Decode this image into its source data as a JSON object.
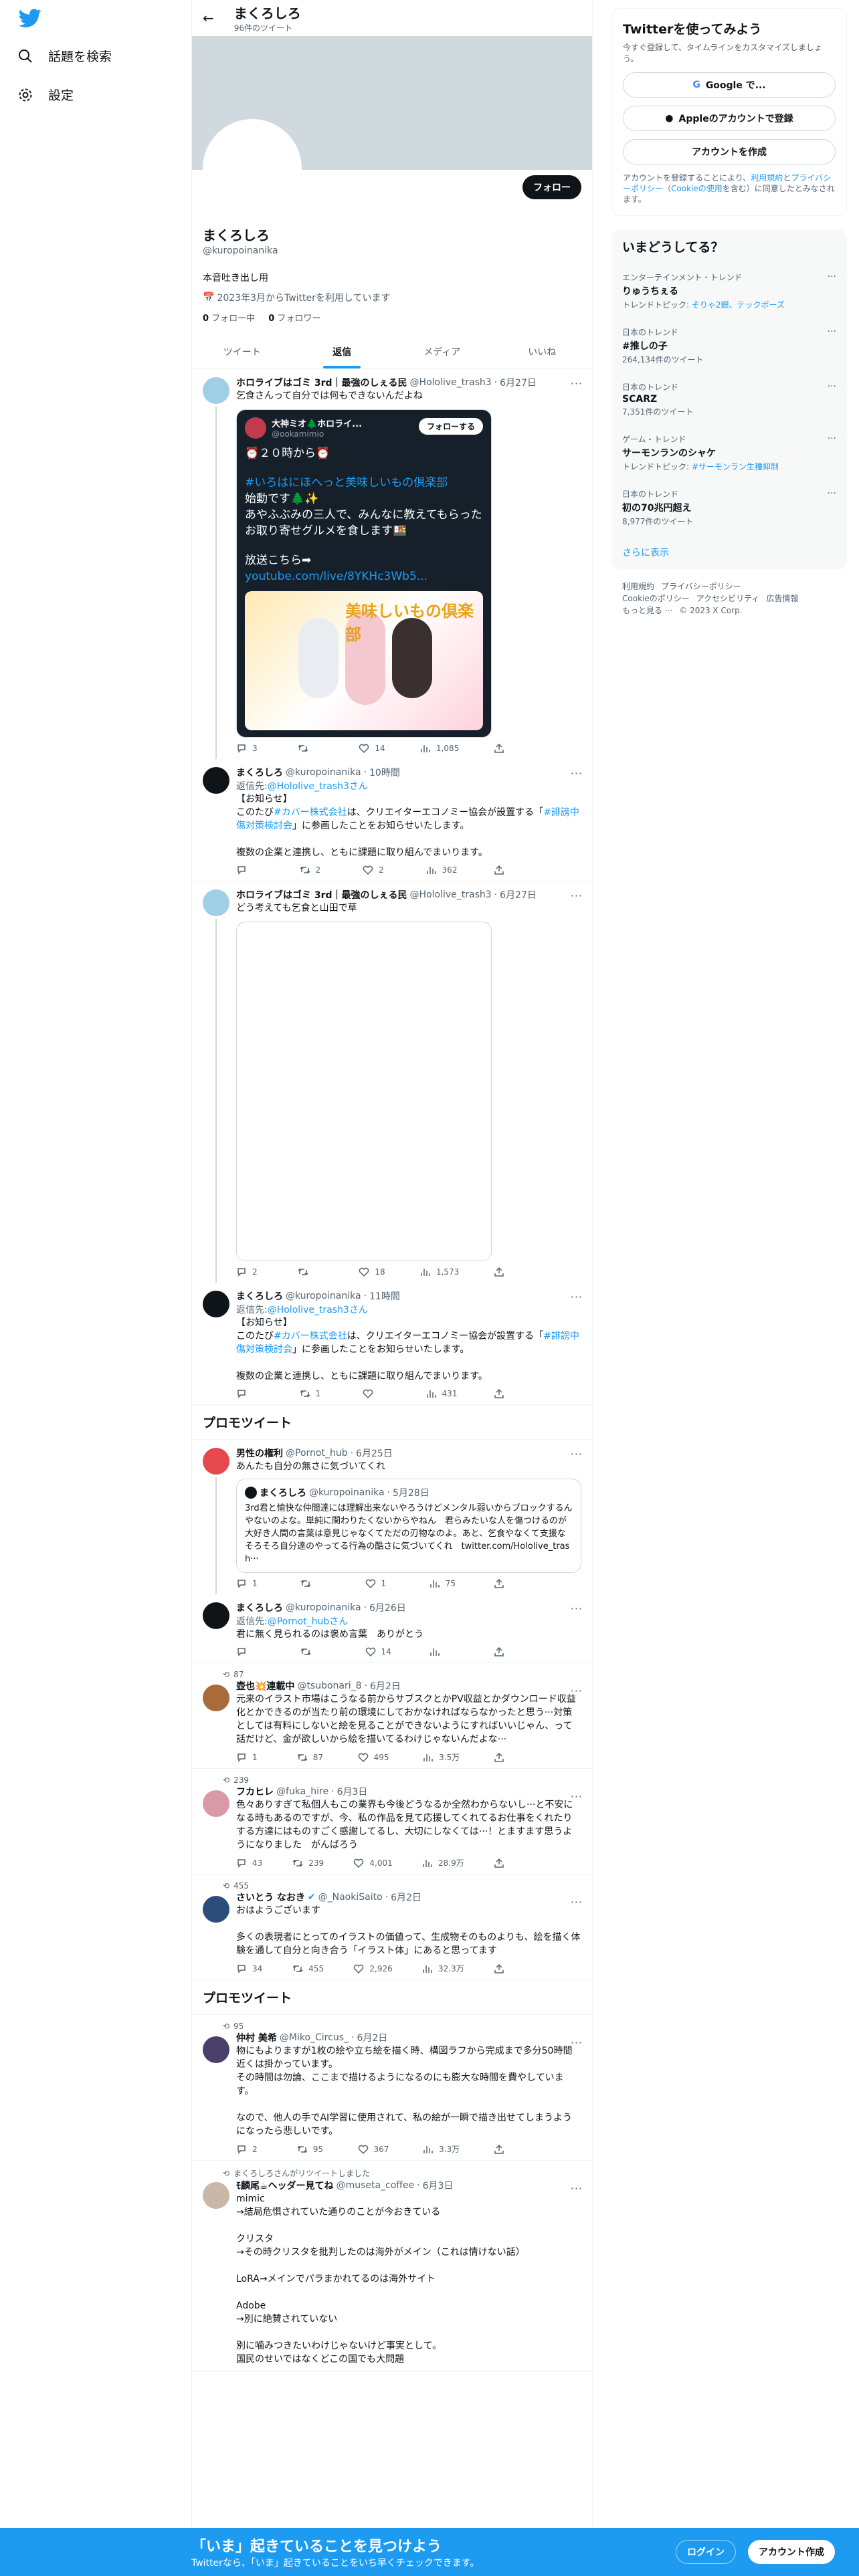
{
  "nav": {
    "explore": "話題を検索",
    "settings": "設定"
  },
  "header": {
    "name": "まくろしろ",
    "tweet_count": "96件のツイート"
  },
  "profile": {
    "follow": "フォロー",
    "name": "まくろしろ",
    "handle": "@kuropoinanika",
    "bio": "本音吐き出し用",
    "joined": "2023年3月からTwitterを利用しています",
    "following_n": "0",
    "following_l": "フォロー中",
    "followers_n": "0",
    "followers_l": "フォロワー"
  },
  "tabs": [
    "ツイート",
    "返信",
    "メディア",
    "いいね"
  ],
  "t1": {
    "name": "ホロライブはゴミ 3rd｜最強のしぇる民",
    "handle": "@Hololive_trash3",
    "date": "6月27日",
    "text": "乞食さんって自分では何もできないんだよね",
    "card": {
      "name": "大神ミオ🌲ホロライ...",
      "handle": "@ookamimio",
      "follow": "フォローする",
      "text1": "⏰２０時から⏰",
      "text2": "#いろはにほへっと美味しいもの倶楽部",
      "text3": "始動です🌲✨\nあやふぶみの三人で、みんなに教えてもらったお取り寄せグルメを食します🍱",
      "text4": "放送こちら➡",
      "link": "youtube.com/live/8YKHc3Wb5...",
      "art": "美味しいもの倶楽部"
    },
    "reply": "3",
    "rt": "",
    "like": "14",
    "views": "1,085"
  },
  "r1": {
    "name": "まくろしろ",
    "handle": "@kuropoinanika",
    "date": "10時間",
    "to": "返信先:",
    "to_h": "@Hololive_trash3さん",
    "l1": "【お知らせ】",
    "l2a": "このたび",
    "l2b": "#カバー株式会社",
    "l2c": "は、クリエイターエコノミー協会が設置する「",
    "l2d": "#誹謗中傷対策検討会",
    "l2e": "」に参画したことをお知らせいたします。",
    "l3": "複数の企業と連携し、ともに課題に取り組んでまいります。",
    "reply": "",
    "rt": "2",
    "like": "2",
    "views": "362"
  },
  "t2": {
    "name": "ホロライブはゴミ 3rd｜最強のしぇる民",
    "handle": "@Hololive_trash3",
    "date": "6月27日",
    "text": "どう考えても乞食と山田で草",
    "reply": "2",
    "rt": "",
    "like": "18",
    "views": "1,573"
  },
  "r2": {
    "name": "まくろしろ",
    "handle": "@kuropoinanika",
    "date": "11時間",
    "to": "返信先:",
    "to_h": "@Hololive_trash3さん",
    "l1": "【お知らせ】",
    "l2a": "このたび",
    "l2b": "#カバー株式会社",
    "l2c": "は、クリエイターエコノミー協会が設置する「",
    "l2d": "#誹謗中傷対策検討会",
    "l2e": "」に参画したことをお知らせいたします。",
    "l3": "複数の企業と連携し、ともに課題に取り組んでまいります。",
    "reply": "",
    "rt": "1",
    "like": "",
    "views": "431"
  },
  "promo": "プロモツイート",
  "t3": {
    "name": "男性の権利",
    "handle": "@Pornot_hub",
    "date": "6月25日",
    "text": "あんたも自分の無さに気づいてくれ",
    "q": {
      "name": "まくろしろ",
      "handle": "@kuropoinanika",
      "date": "5月28日",
      "text": "3rd君と愉快な仲間達には理解出来ないやろうけどメンタル弱いからブロックするんやないのよな。単純に関わりたくないからやねん　君らみたいな人を傷つけるのが大好き人間の言葉は意見じゃなくてただの刃物なのよ。あと、乞食やなくて支援な　そろそろ自分達のやってる行為の酷さに気づいてくれ　twitter.com/Hololive_trash···"
    },
    "reply": "1",
    "rt": "",
    "like": "1",
    "views": "75"
  },
  "r3": {
    "name": "まくろしろ",
    "handle": "@kuropoinanika",
    "date": "6月26日",
    "to": "返信先:",
    "to_h": "@Pornot_hubさん",
    "text": "君に無く見られるのは褒め言葉　ありがとう",
    "reply": "",
    "rt": "",
    "like": "14",
    "views": ""
  },
  "t4": {
    "rt": "87",
    "name": "壺也💥連載中",
    "handle": "@tsubonari_8",
    "date": "6月2日",
    "text": "元来のイラスト市場はこうなる前からサブスクとかPV収益とかダウンロード収益化とかできるのが当たり前の環境にしておかなければならなかったと思う···対策としては有料にしないと絵を見ることができないようにすればいいじゃん、って話だけど、金が欲しいから絵を描いてるわけじゃないんだよな···",
    "reply": "1",
    "like": "495",
    "views": "3.5万"
  },
  "t5": {
    "rt": "239",
    "name": "フカヒレ",
    "handle": "@fuka_hire",
    "date": "6月3日",
    "text": "色々ありすぎて私個人もこの業界も今後どうなるか全然わからないし···と不安になる時もあるのですが、今、私の作品を見て応援してくれてるお仕事をくれたりする方達にはものすごく感謝してるし、大切にしなくては···！とますます思うようになりました　がんばろう",
    "reply": "43",
    "like": "4,001",
    "views": "28.9万"
  },
  "t6": {
    "rt": "455",
    "name": "さいとう なおき",
    "handle": "@_NaokiSaito",
    "date": "6月2日",
    "text": "おはようございます\n\n多くの表現者にとってのイラストの価値って、生成物そのものよりも、絵を描く体験を通して自分と向き合う「イラスト体」にあると思ってます",
    "reply": "34",
    "like": "2,926",
    "views": "32.3万"
  },
  "t7": {
    "rt": "95",
    "name": "仲村 美希",
    "handle": "@Miko_Circus_",
    "date": "6月2日",
    "text": "物にもよりますが1枚の絵や立ち絵を描く時、構図ラフから完成まで多分50時間近くは掛かっています。\nその時間は勿論、ここまで描けるようになるのにも膨大な時間を費やしています。\n\nなので、他人の手でAI学習に使用されて、私の絵が一瞬で描き出せてしまうようになったら悲しいです。",
    "reply": "2",
    "like": "367",
    "views": "3.3万"
  },
  "t8": {
    "rt": "まくろしろさんがリツイートしました",
    "name": "ﾓ麟尾☕ヘッダー見てね",
    "handle": "@museta_coffee",
    "date": "6月3日",
    "text": "mimic\n→結局危惧されていた通りのことが今おきている\n\nクリスタ\n→その時クリスタを批判したのは海外がメイン（これは情けない話）\n\nLoRA→メインでパラまかれてるのは海外サイト\n\nAdobe\n→別に絶賛されていない\n\n別に噛みつきたいわけじゃないけど事実として。\n国民のせいではなくどこの国でも大問題"
  },
  "signup": {
    "title": "Twitterを使ってみよう",
    "desc": "今すぐ登録して、タイムラインをカスタマイズしましょう。",
    "google": "Google で...",
    "apple": "Appleのアカウントで登録",
    "create": "アカウントを作成",
    "legal_a": "アカウントを登録することにより、",
    "legal_b": "利用規約",
    "legal_c": "と",
    "legal_d": "プライバシーポリシー",
    "legal_e": "（",
    "legal_f": "Cookieの使用",
    "legal_g": "を含む）に同意したとみなされます。"
  },
  "trends_title": "いまどうしてる？",
  "trends": [
    {
      "c": "エンターテインメント・トレンド",
      "t": "りゅうちぇる",
      "n_a": "トレンドトピック: ",
      "n_b": "そりゃ2銀、テックポーズ"
    },
    {
      "c": "日本のトレンド",
      "t": "#推しの子",
      "n_a": "264,134件のツイート",
      "n_b": ""
    },
    {
      "c": "日本のトレンド",
      "t": "SCARZ",
      "n_a": "7,351件のツイート",
      "n_b": ""
    },
    {
      "c": "ゲーム・トレンド",
      "t": "サーモンランのシャケ",
      "n_a": "トレンドトピック: ",
      "n_b": "#サーモンラン生種抑制"
    },
    {
      "c": "日本のトレンド",
      "t": "初の70兆円超え",
      "n_a": "8,977件のツイート",
      "n_b": ""
    }
  ],
  "show_more": "さらに表示",
  "footer": [
    "利用規約",
    "プライバシーポリシー",
    "Cookieのポリシー",
    "アクセシビリティ",
    "広告情報",
    "もっと見る ···",
    "© 2023 X Corp."
  ],
  "bottom": {
    "title": "「いま」起きていることを見つけよう",
    "sub": "Twitterなら、「いま」起きていることをいち早くチェックできます。",
    "login": "ログイン",
    "signup": "アカウント作成"
  }
}
